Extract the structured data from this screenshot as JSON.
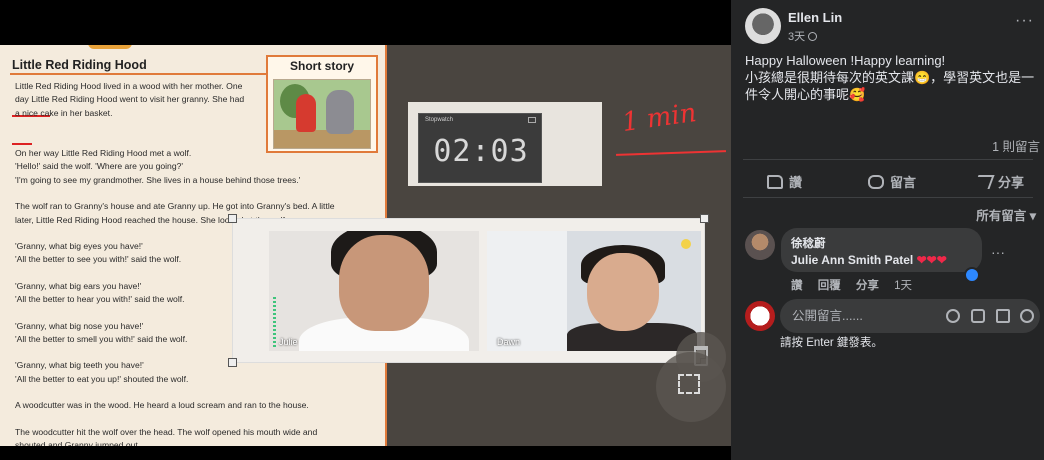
{
  "media": {
    "document": {
      "title": "Little Red Riding Hood",
      "story_label": "Short story",
      "paragraphs": [
        "Little Red Riding Hood lived in a wood with her mother. One\nday Little Red Riding Hood went to visit her granny. She had\na nice cake in her basket.",
        "On her way Little Red Riding Hood met a wolf.\n'Hello!' said the wolf. 'Where are you going?'\n'I'm going to see my grandmother. She lives in a house behind those trees.'",
        "The wolf ran to Granny's house and ate Granny up. He got into Granny's bed. A little\nlater, Little Red Riding Hood reached the house. She looked at the wolf.",
        "'Granny, what big eyes you have!'\n'All the better to see you with!' said the wolf.",
        "'Granny, what big ears you have!'\n'All the better to hear you with!' said the wolf.",
        "'Granny, what big nose you have!'\n'All the better to smell you with!' said the wolf.",
        "'Granny, what big teeth you have!'\n'All the better to eat you up!' shouted the wolf.",
        "A woodcutter was in the wood. He heard a loud scream and ran to the house.",
        "The woodcutter hit the wolf over the head. The wolf opened his mouth wide and\nshouted and Granny jumped out."
      ]
    },
    "stopwatch": {
      "title": "Stopwatch",
      "time": "02:03"
    },
    "handwritten_note": "1 min",
    "video_tiles": [
      {
        "name": "Julie",
        "icon": "microphone-icon"
      },
      {
        "name": "Dawn",
        "icon": "microphone-icon"
      }
    ]
  },
  "post": {
    "author": "Ellen Lin",
    "time": "3天",
    "text": "Happy Halloween !Happy learning!\n小孩總是很期待每次的英文課😁，學習英文也是一件令人開心的事呢🥰",
    "comment_count": "1 則留言",
    "actions": {
      "like": "讚",
      "comment": "留言",
      "share": "分享"
    },
    "sort_label": "所有留言",
    "accent_color": "#2d88ff"
  },
  "comment": {
    "author": "徐稔蔚",
    "text": "Julie Ann Smith Patel",
    "hearts": "❤❤❤",
    "like": "讚",
    "reply": "回覆",
    "share": "分享",
    "time": "1天"
  },
  "composer": {
    "placeholder": "公開留言......",
    "hint": "請按 Enter 鍵發表。"
  }
}
